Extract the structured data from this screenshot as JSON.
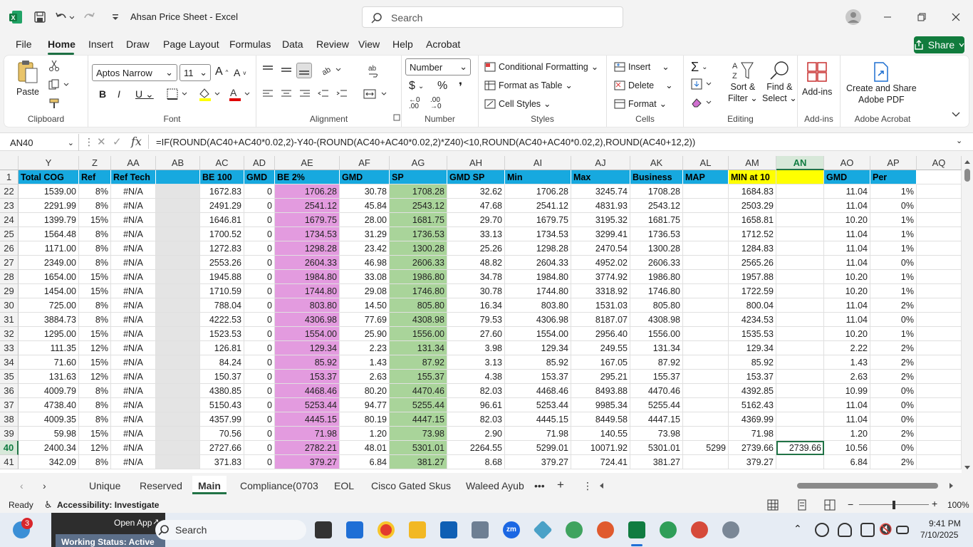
{
  "app": {
    "title": "Ahsan Price Sheet  -  Excel",
    "search_placeholder": "Search"
  },
  "menu": [
    "File",
    "Home",
    "Insert",
    "Draw",
    "Page Layout",
    "Formulas",
    "Data",
    "Review",
    "View",
    "Help",
    "Acrobat"
  ],
  "share": "Share",
  "ribbon": {
    "clipboard": {
      "label": "Clipboard",
      "paste": "Paste"
    },
    "font": {
      "label": "Font",
      "name": "Aptos Narrow",
      "size": "11"
    },
    "alignment": {
      "label": "Alignment"
    },
    "number": {
      "label": "Number",
      "format": "Number"
    },
    "styles": {
      "label": "Styles",
      "conditional": "Conditional Formatting",
      "table": "Format as Table",
      "cell_styles": "Cell Styles"
    },
    "cells": {
      "label": "Cells",
      "insert": "Insert",
      "delete": "Delete",
      "format": "Format"
    },
    "editing": {
      "label": "Editing",
      "sort": "Sort &",
      "filter": "Filter",
      "find": "Find &",
      "select": "Select"
    },
    "addins": {
      "label": "Add-ins",
      "btn": "Add-ins"
    },
    "acrobat": {
      "label": "Adobe Acrobat",
      "btn1": "Create and Share",
      "btn2": "Adobe PDF"
    }
  },
  "formula_bar": {
    "name_box": "AN40",
    "formula": "=IF(ROUND(AC40+AC40*0.02,2)-Y40-(ROUND(AC40+AC40*0.02,2)*Z40)<10,ROUND(AC40+AC40*0.02,2),ROUND(AC40+12,2))"
  },
  "columns": [
    "Y",
    "Z",
    "AA",
    "AB",
    "AC",
    "AD",
    "AE",
    "AF",
    "AG",
    "AH",
    "AI",
    "AJ",
    "AK",
    "AL",
    "AM",
    "AN",
    "AO",
    "AP",
    "AQ"
  ],
  "header_row": [
    "Total COG",
    "Ref",
    "Ref Tech",
    "",
    "BE 100",
    "GMD",
    "BE 2%",
    "GMD",
    "SP",
    "GMD SP",
    "Min",
    "Max",
    "Business",
    "MAP",
    "MIN at 10",
    "",
    "GMD",
    "Per",
    ""
  ],
  "rows": [
    [
      "22",
      "1539.00",
      "8%",
      "#N/A",
      "",
      "1672.83",
      "0",
      "1706.28",
      "30.78",
      "1708.28",
      "32.62",
      "1706.28",
      "3245.74",
      "1708.28",
      "",
      "1684.83",
      "",
      "11.04",
      "1%"
    ],
    [
      "23",
      "2291.99",
      "8%",
      "#N/A",
      "",
      "2491.29",
      "0",
      "2541.12",
      "45.84",
      "2543.12",
      "47.68",
      "2541.12",
      "4831.93",
      "2543.12",
      "",
      "2503.29",
      "",
      "11.04",
      "0%"
    ],
    [
      "24",
      "1399.79",
      "15%",
      "#N/A",
      "",
      "1646.81",
      "0",
      "1679.75",
      "28.00",
      "1681.75",
      "29.70",
      "1679.75",
      "3195.32",
      "1681.75",
      "",
      "1658.81",
      "",
      "10.20",
      "1%"
    ],
    [
      "25",
      "1564.48",
      "8%",
      "#N/A",
      "",
      "1700.52",
      "0",
      "1734.53",
      "31.29",
      "1736.53",
      "33.13",
      "1734.53",
      "3299.41",
      "1736.53",
      "",
      "1712.52",
      "",
      "11.04",
      "1%"
    ],
    [
      "26",
      "1171.00",
      "8%",
      "#N/A",
      "",
      "1272.83",
      "0",
      "1298.28",
      "23.42",
      "1300.28",
      "25.26",
      "1298.28",
      "2470.54",
      "1300.28",
      "",
      "1284.83",
      "",
      "11.04",
      "1%"
    ],
    [
      "27",
      "2349.00",
      "8%",
      "#N/A",
      "",
      "2553.26",
      "0",
      "2604.33",
      "46.98",
      "2606.33",
      "48.82",
      "2604.33",
      "4952.02",
      "2606.33",
      "",
      "2565.26",
      "",
      "11.04",
      "0%"
    ],
    [
      "28",
      "1654.00",
      "15%",
      "#N/A",
      "",
      "1945.88",
      "0",
      "1984.80",
      "33.08",
      "1986.80",
      "34.78",
      "1984.80",
      "3774.92",
      "1986.80",
      "",
      "1957.88",
      "",
      "10.20",
      "1%"
    ],
    [
      "29",
      "1454.00",
      "15%",
      "#N/A",
      "",
      "1710.59",
      "0",
      "1744.80",
      "29.08",
      "1746.80",
      "30.78",
      "1744.80",
      "3318.92",
      "1746.80",
      "",
      "1722.59",
      "",
      "10.20",
      "1%"
    ],
    [
      "30",
      "725.00",
      "8%",
      "#N/A",
      "",
      "788.04",
      "0",
      "803.80",
      "14.50",
      "805.80",
      "16.34",
      "803.80",
      "1531.03",
      "805.80",
      "",
      "800.04",
      "",
      "11.04",
      "2%"
    ],
    [
      "31",
      "3884.73",
      "8%",
      "#N/A",
      "",
      "4222.53",
      "0",
      "4306.98",
      "77.69",
      "4308.98",
      "79.53",
      "4306.98",
      "8187.07",
      "4308.98",
      "",
      "4234.53",
      "",
      "11.04",
      "0%"
    ],
    [
      "32",
      "1295.00",
      "15%",
      "#N/A",
      "",
      "1523.53",
      "0",
      "1554.00",
      "25.90",
      "1556.00",
      "27.60",
      "1554.00",
      "2956.40",
      "1556.00",
      "",
      "1535.53",
      "",
      "10.20",
      "1%"
    ],
    [
      "33",
      "111.35",
      "12%",
      "#N/A",
      "",
      "126.81",
      "0",
      "129.34",
      "2.23",
      "131.34",
      "3.98",
      "129.34",
      "249.55",
      "131.34",
      "",
      "129.34",
      "",
      "2.22",
      "2%"
    ],
    [
      "34",
      "71.60",
      "15%",
      "#N/A",
      "",
      "84.24",
      "0",
      "85.92",
      "1.43",
      "87.92",
      "3.13",
      "85.92",
      "167.05",
      "87.92",
      "",
      "85.92",
      "",
      "1.43",
      "2%"
    ],
    [
      "35",
      "131.63",
      "12%",
      "#N/A",
      "",
      "150.37",
      "0",
      "153.37",
      "2.63",
      "155.37",
      "4.38",
      "153.37",
      "295.21",
      "155.37",
      "",
      "153.37",
      "",
      "2.63",
      "2%"
    ],
    [
      "36",
      "4009.79",
      "8%",
      "#N/A",
      "",
      "4380.85",
      "0",
      "4468.46",
      "80.20",
      "4470.46",
      "82.03",
      "4468.46",
      "8493.88",
      "4470.46",
      "",
      "4392.85",
      "",
      "10.99",
      "0%"
    ],
    [
      "37",
      "4738.40",
      "8%",
      "#N/A",
      "",
      "5150.43",
      "0",
      "5253.44",
      "94.77",
      "5255.44",
      "96.61",
      "5253.44",
      "9985.34",
      "5255.44",
      "",
      "5162.43",
      "",
      "11.04",
      "0%"
    ],
    [
      "38",
      "4009.35",
      "8%",
      "#N/A",
      "",
      "4357.99",
      "0",
      "4445.15",
      "80.19",
      "4447.15",
      "82.03",
      "4445.15",
      "8449.58",
      "4447.15",
      "",
      "4369.99",
      "",
      "11.04",
      "0%"
    ],
    [
      "39",
      "59.98",
      "15%",
      "#N/A",
      "",
      "70.56",
      "0",
      "71.98",
      "1.20",
      "73.98",
      "2.90",
      "71.98",
      "140.55",
      "73.98",
      "",
      "71.98",
      "",
      "1.20",
      "2%"
    ],
    [
      "40",
      "2400.34",
      "12%",
      "#N/A",
      "",
      "2727.66",
      "0",
      "2782.21",
      "48.01",
      "5301.01",
      "2264.55",
      "5299.01",
      "10071.92",
      "5301.01",
      "5299",
      "2739.66",
      "2739.66",
      "10.56",
      "0%"
    ],
    [
      "41",
      "342.09",
      "8%",
      "#N/A",
      "",
      "371.83",
      "0",
      "379.27",
      "6.84",
      "381.27",
      "8.68",
      "379.27",
      "724.41",
      "381.27",
      "",
      "379.27",
      "",
      "6.84",
      "2%"
    ]
  ],
  "sheets": [
    "Unique",
    "Reserved",
    "Main",
    "Compliance(0703",
    "EOL",
    "Cisco Gated Skus",
    "Waleed Ayub"
  ],
  "status": {
    "ready": "Ready",
    "accessibility": "Accessibility: Investigate",
    "zoom": "100%"
  },
  "taskbar": {
    "search": "Search",
    "open_app": "Open App",
    "working": "Working Status: Active",
    "time": "9:41 PM",
    "date": "7/10/2025",
    "badge": "3"
  }
}
